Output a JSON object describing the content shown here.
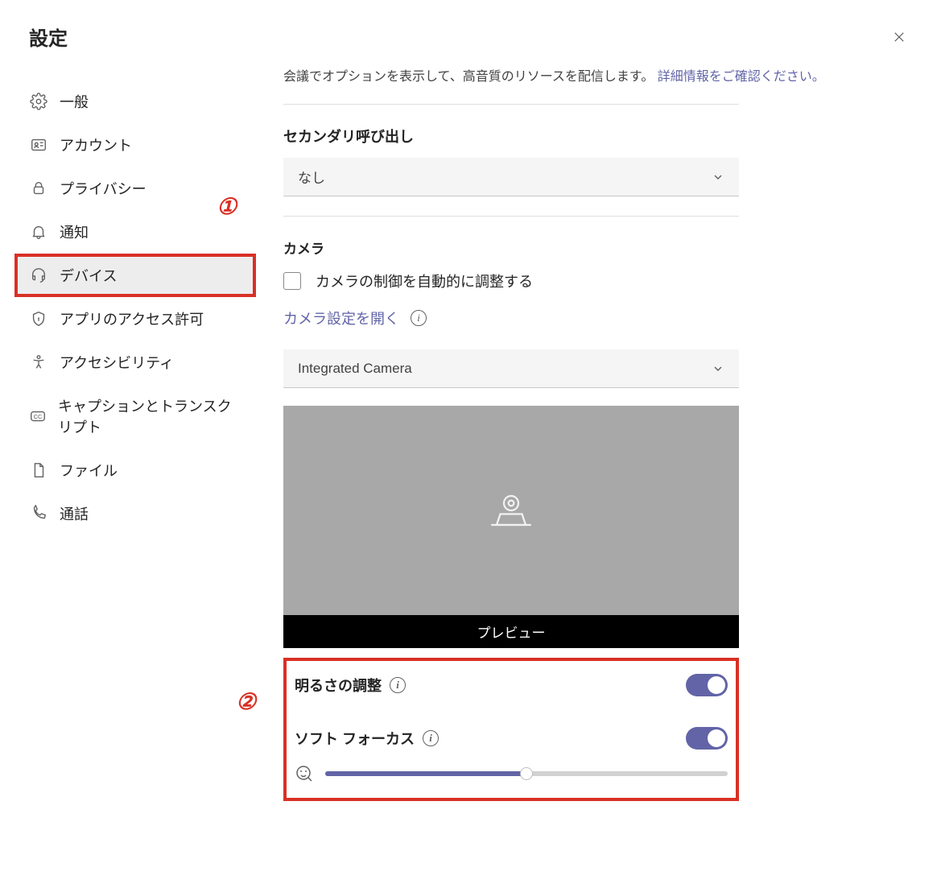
{
  "header": {
    "title": "設定"
  },
  "sidebar": {
    "items": [
      {
        "label": "一般"
      },
      {
        "label": "アカウント"
      },
      {
        "label": "プライバシー"
      },
      {
        "label": "通知"
      },
      {
        "label": "デバイス"
      },
      {
        "label": "アプリのアクセス許可"
      },
      {
        "label": "アクセシビリティ"
      },
      {
        "label": "キャプションとトランスクリプト"
      },
      {
        "label": "ファイル"
      },
      {
        "label": "通話"
      }
    ]
  },
  "content": {
    "partial_text": "会議でオプションを表示して、高音質のリソースを配信します。",
    "partial_link": "詳細情報をご確認ください。",
    "secondary": {
      "label": "セカンダリ呼び出し",
      "value": "なし"
    },
    "camera": {
      "label": "カメラ",
      "auto_adjust": "カメラの制御を自動的に調整する",
      "open_settings": "カメラ設定を開く",
      "selected": "Integrated Camera",
      "preview_label": "プレビュー"
    },
    "brightness": {
      "label": "明るさの調整",
      "on": true
    },
    "softfocus": {
      "label": "ソフト フォーカス",
      "on": true,
      "value": 50
    }
  },
  "annotations": {
    "one": "①",
    "two": "②"
  }
}
